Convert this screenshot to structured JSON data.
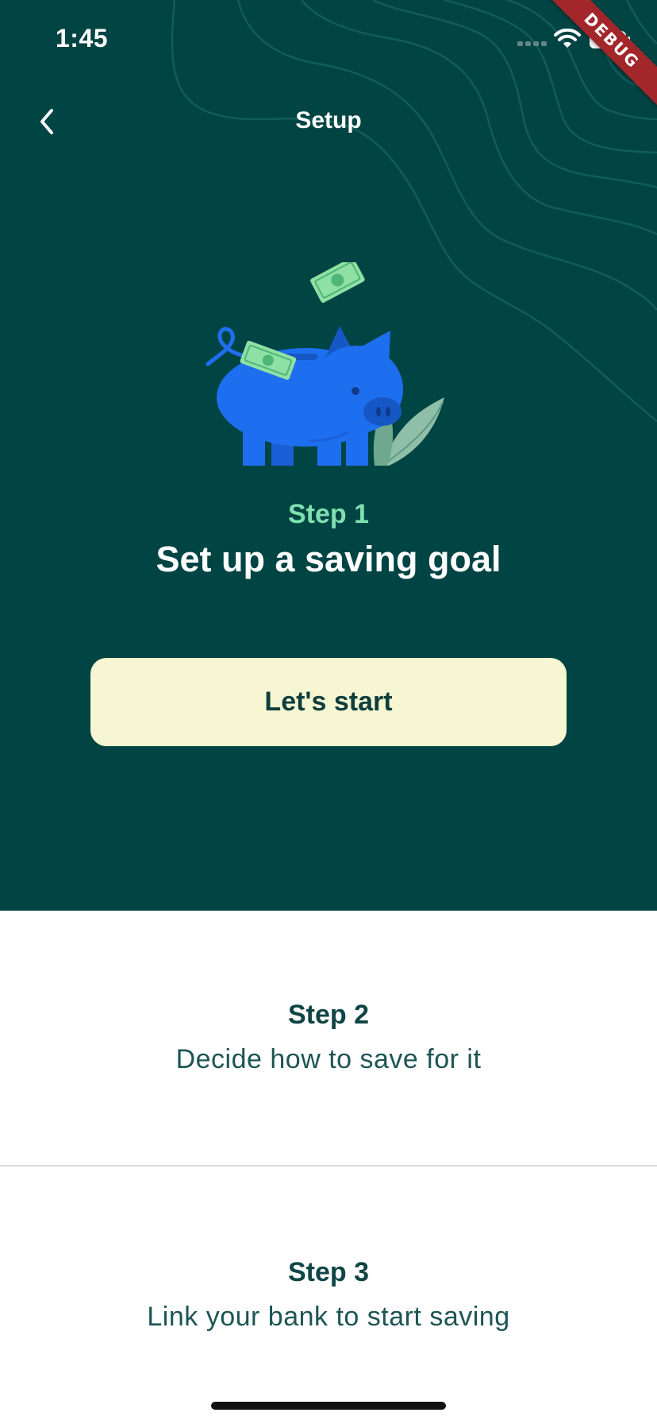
{
  "status_bar": {
    "time": "1:45",
    "icons": [
      "signal-icon",
      "wifi-icon",
      "battery-icon"
    ]
  },
  "debug_banner": "DEBUG",
  "nav": {
    "back_icon": "chevron-left-icon",
    "title": "Setup"
  },
  "hero": {
    "illustration": "piggy-bank-with-money-illustration",
    "step_label": "Step 1",
    "step_title": "Set up a saving goal",
    "button_label": "Let's start"
  },
  "steps": [
    {
      "label": "Step 2",
      "description": "Decide how to save for it"
    },
    {
      "label": "Step 3",
      "description": "Link your bank to start saving"
    }
  ],
  "colors": {
    "hero_background": "#004443",
    "accent_green": "#7fe0b0",
    "button_background": "#f6f7d2",
    "text_dark": "#0f4544",
    "piggy_blue": "#1e6ff0",
    "debug_banner": "#a3262b"
  }
}
